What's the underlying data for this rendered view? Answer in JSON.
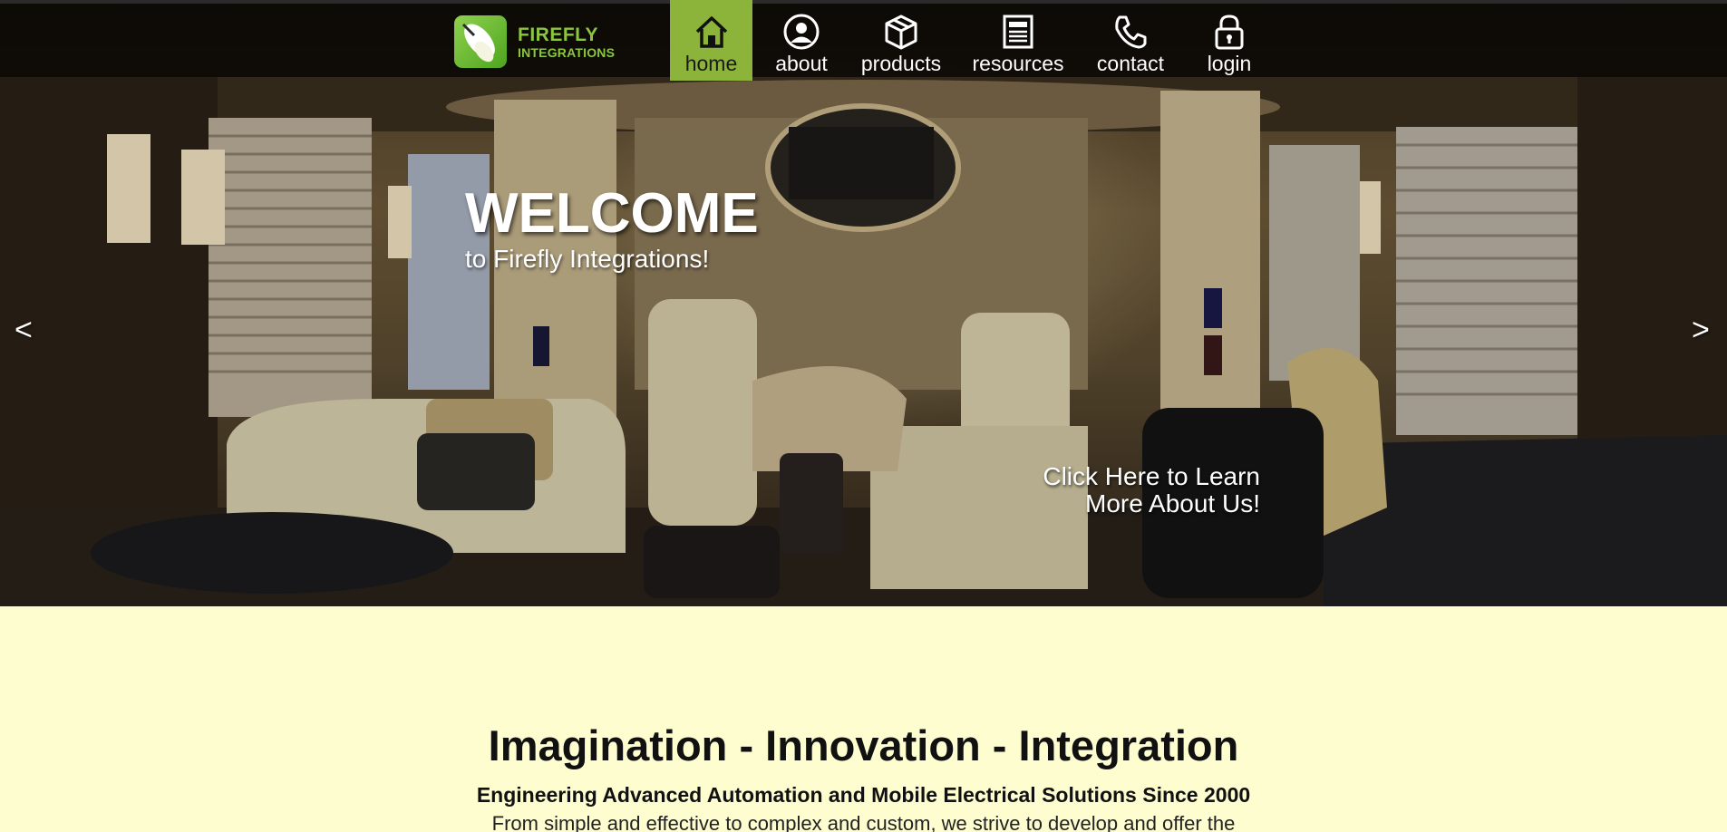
{
  "brand": {
    "line1": "FIREFLY",
    "line2": "INTEGRATIONS",
    "accent_color": "#8cc63f"
  },
  "nav": {
    "items": [
      {
        "label": "home",
        "icon": "home-icon",
        "active": true
      },
      {
        "label": "about",
        "icon": "user-icon",
        "active": false
      },
      {
        "label": "products",
        "icon": "box-icon",
        "active": false
      },
      {
        "label": "resources",
        "icon": "newspaper-icon",
        "active": false
      },
      {
        "label": "contact",
        "icon": "phone-icon",
        "active": false
      },
      {
        "label": "login",
        "icon": "lock-icon",
        "active": false
      }
    ],
    "active_color": "#8cb43a"
  },
  "hero": {
    "title": "WELCOME",
    "subtitle": "to Firefly Integrations!",
    "prev_arrow": "<",
    "next_arrow": ">",
    "cta_line1": "Click Here to Learn",
    "cta_line2": "More About Us!"
  },
  "content": {
    "tagline": "Imagination - Innovation - Integration",
    "subtagline": "Engineering Advanced Automation and Mobile Electrical Solutions Since 2000",
    "description": "From simple and effective to complex and custom, we strive to develop and offer the"
  }
}
